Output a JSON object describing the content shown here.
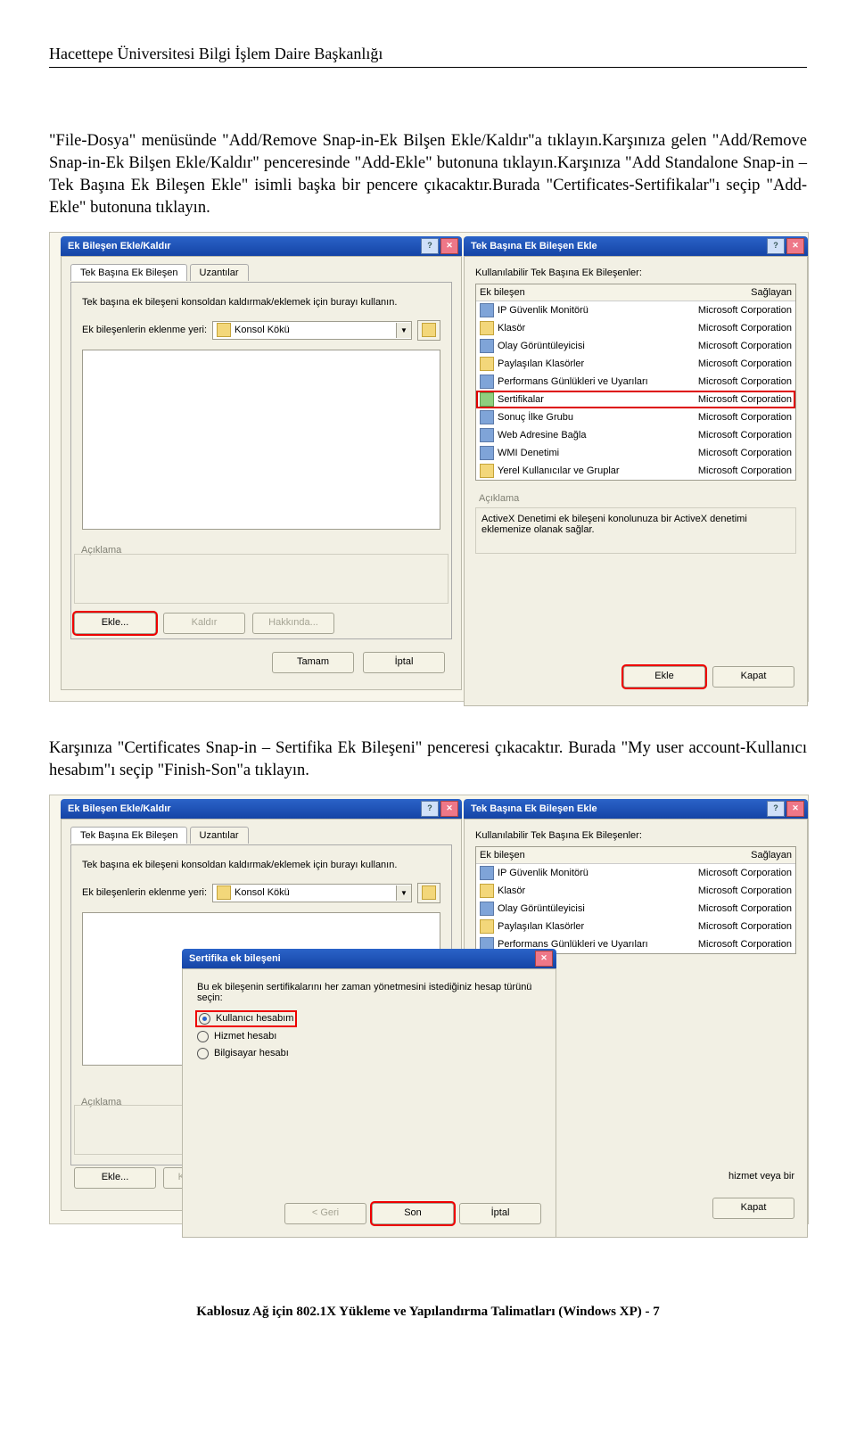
{
  "header": {
    "title": "Hacettepe Üniversitesi Bilgi İşlem Daire Başkanlığı"
  },
  "paragraph1": "\"File-Dosya\" menüsünde \"Add/Remove Snap-in-Ek Bilşen Ekle/Kaldır\"a tıklayın.Karşınıza gelen \"Add/Remove Snap-in-Ek Bilşen Ekle/Kaldır\" penceresinde \"Add-Ekle\" butonuna tıklayın.Karşınıza \"Add Standalone Snap-in – Tek Başına Ek Bileşen Ekle\" isimli başka bir pencere çıkacaktır.Burada \"Certificates-Sertifikalar\"ı seçip \"Add-Ekle\" butonuna tıklayın.",
  "paragraph2": "Karşınıza \"Certificates Snap-in – Sertifika Ek Bileşeni\" penceresi çıkacaktır. Burada \"My user account-Kullanıcı hesabım\"ı seçip \"Finish-Son\"a tıklayın.",
  "footer": "Kablosuz Ağ için 802.1X Yükleme ve Yapılandırma Talimatları (Windows XP) - 7",
  "shot1": {
    "leftTitlebar": "Ek Bileşen Ekle/Kaldır",
    "tabActive": "Tek Başına Ek Bileşen",
    "tabOther": "Uzantılar",
    "desc": "Tek başına ek bileşeni konsoldan kaldırmak/eklemek için burayı kullanın.",
    "locLabel": "Ek bileşenlerin eklenme yeri:",
    "locValue": "Konsol Kökü",
    "groupLabel": "Açıklama",
    "btnAdd": "Ekle...",
    "btnRemove": "Kaldır",
    "btnAbout": "Hakkında...",
    "btnOk": "Tamam",
    "btnCancel": "İptal",
    "rp": {
      "title": "Tek Başına Ek Bileşen Ekle",
      "label1": "Kullanılabilir Tek Başına Ek Bileşenler:",
      "colSnap": "Ek bileşen",
      "colVendor": "Sağlayan",
      "items": [
        {
          "name": "IP Güvenlik Monitörü",
          "vendor": "Microsoft Corporation",
          "ico": "blue"
        },
        {
          "name": "Klasör",
          "vendor": "Microsoft Corporation",
          "ico": "folder"
        },
        {
          "name": "Olay Görüntüleyicisi",
          "vendor": "Microsoft Corporation",
          "ico": "blue"
        },
        {
          "name": "Paylaşılan Klasörler",
          "vendor": "Microsoft Corporation",
          "ico": "folder"
        },
        {
          "name": "Performans Günlükleri ve Uyarıları",
          "vendor": "Microsoft Corporation",
          "ico": "blue"
        },
        {
          "name": "Sertifikalar",
          "vendor": "Microsoft Corporation",
          "ico": "green",
          "highlight": true
        },
        {
          "name": "Sonuç İlke Grubu",
          "vendor": "Microsoft Corporation",
          "ico": "blue"
        },
        {
          "name": "Web Adresine Bağla",
          "vendor": "Microsoft Corporation",
          "ico": "blue"
        },
        {
          "name": "WMI Denetimi",
          "vendor": "Microsoft Corporation",
          "ico": "blue"
        },
        {
          "name": "Yerel Kullanıcılar ve Gruplar",
          "vendor": "Microsoft Corporation",
          "ico": "folder"
        }
      ],
      "descLabel": "Açıklama",
      "descText": "ActiveX Denetimi ek bileşeni konolunuza bir ActiveX denetimi eklemenize olanak sağlar.",
      "btnAdd": "Ekle",
      "btnClose": "Kapat"
    }
  },
  "shot2": {
    "leftTitlebar": "Ek Bileşen Ekle/Kaldır",
    "tabActive": "Tek Başına Ek Bileşen",
    "tabOther": "Uzantılar",
    "desc": "Tek başına ek bileşeni konsoldan kaldırmak/eklemek için burayı kullanın.",
    "locLabel": "Ek bileşenlerin eklenme yeri:",
    "locValue": "Konsol Kökü",
    "groupLabel": "Açıklama",
    "btnAdd": "Ekle...",
    "btnRemove": "Kaldır",
    "rp": {
      "title": "Tek Başına Ek Bileşen Ekle",
      "label1": "Kullanılabilir Tek Başına Ek Bileşenler:",
      "colSnap": "Ek bileşen",
      "colVendor": "Sağlayan",
      "items": [
        {
          "name": "IP Güvenlik Monitörü",
          "vendor": "Microsoft Corporation",
          "ico": "blue"
        },
        {
          "name": "Klasör",
          "vendor": "Microsoft Corporation",
          "ico": "folder"
        },
        {
          "name": "Olay Görüntüleyicisi",
          "vendor": "Microsoft Corporation",
          "ico": "blue"
        },
        {
          "name": "Paylaşılan Klasörler",
          "vendor": "Microsoft Corporation",
          "ico": "folder"
        },
        {
          "name": "Performans Günlükleri ve Uyarıları",
          "vendor": "Microsoft Corporation",
          "ico": "blue"
        }
      ],
      "descTrunc": "hizmet veya bir",
      "btnClose": "Kapat"
    },
    "cert": {
      "title": "Sertifika ek bileşeni",
      "prompt": "Bu ek bileşenin sertifikalarını her zaman yönetmesini istediğiniz hesap türünü seçin:",
      "opt1": "Kullanıcı hesabım",
      "opt2": "Hizmet hesabı",
      "opt3": "Bilgisayar hesabı",
      "btnBack": "< Geri",
      "btnFinish": "Son",
      "btnCancel": "İptal"
    }
  }
}
